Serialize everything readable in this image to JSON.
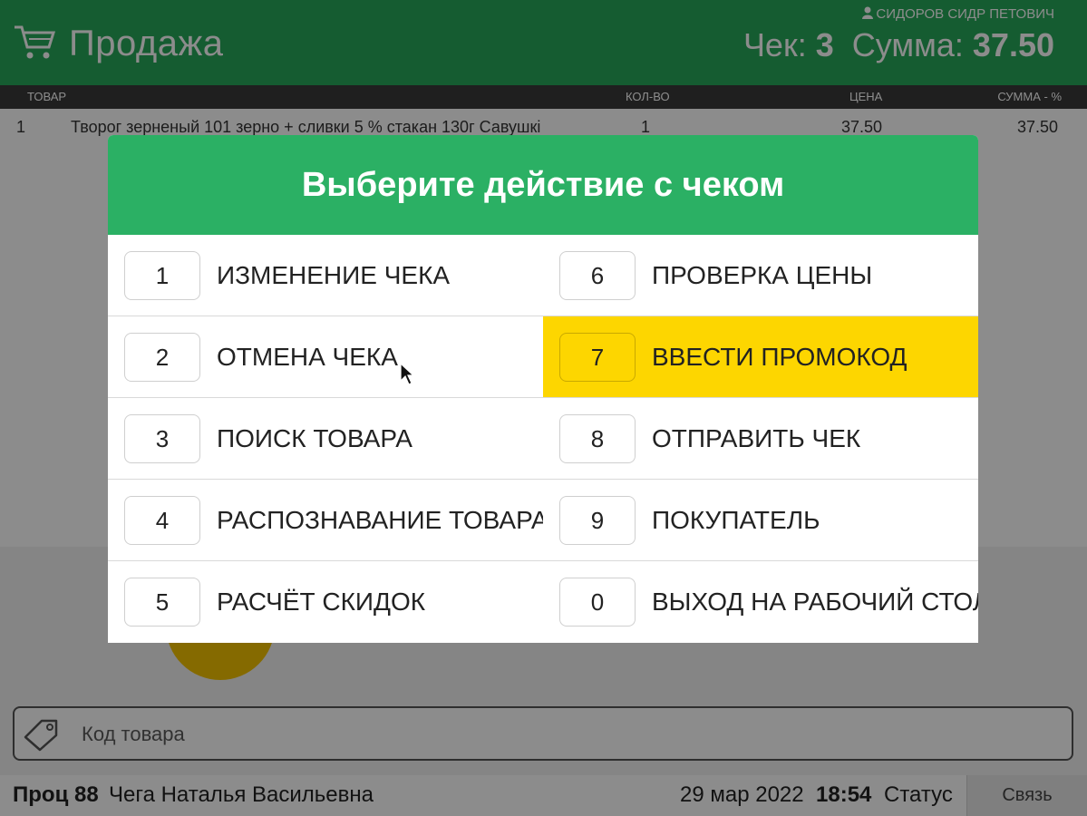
{
  "header": {
    "title": "Продажа",
    "user": "СИДОРОВ СИДР ПЕТОВИЧ",
    "receipt_label": "Чек:",
    "receipt_number": "3",
    "sum_label": "Сумма:",
    "sum_value": "37.50"
  },
  "table": {
    "columns": [
      "ТОВАР",
      "КОЛ-ВО",
      "ЦЕНА",
      "СУММА - %"
    ],
    "rows": [
      {
        "num": "1",
        "name": "Творог зерненый 101 зерно + сливки 5 % стакан 130г Савушкі",
        "qty": "1",
        "price": "37.50",
        "sum": "37.50"
      }
    ]
  },
  "modal": {
    "title": "Выберите действие с чеком",
    "options": [
      {
        "key": "1",
        "label": "ИЗМЕНЕНИЕ ЧЕКА"
      },
      {
        "key": "2",
        "label": "ОТМЕНА ЧЕКА"
      },
      {
        "key": "3",
        "label": "ПОИСК ТОВАРА"
      },
      {
        "key": "4",
        "label": "РАСПОЗНАВАНИЕ ТОВАРА"
      },
      {
        "key": "5",
        "label": "РАСЧЁТ СКИДОК"
      },
      {
        "key": "6",
        "label": "ПРОВЕРКА ЦЕНЫ"
      },
      {
        "key": "7",
        "label": "ВВЕСТИ ПРОМОКОД"
      },
      {
        "key": "8",
        "label": "ОТПРАВИТЬ ЧЕК"
      },
      {
        "key": "9",
        "label": "ПОКУПАТЕЛЬ"
      },
      {
        "key": "0",
        "label": "ВЫХОД НА РАБОЧИЙ СТОЛ"
      }
    ],
    "selected_key": "7",
    "header_color": "#2bb064",
    "highlight_color": "#fdd600"
  },
  "search": {
    "placeholder": "Код товара"
  },
  "status_bar": {
    "proc_label": "Проц",
    "proc_number": "88",
    "cashier": "Чега Наталья Васильевна",
    "date": "29 мар 2022",
    "time": "18:54",
    "status": "Статус",
    "link_button": "Связь"
  },
  "icons": {
    "cart": "cart-icon",
    "user": "user-icon",
    "tag": "tag-icon",
    "pointer": "mouse-cursor"
  }
}
